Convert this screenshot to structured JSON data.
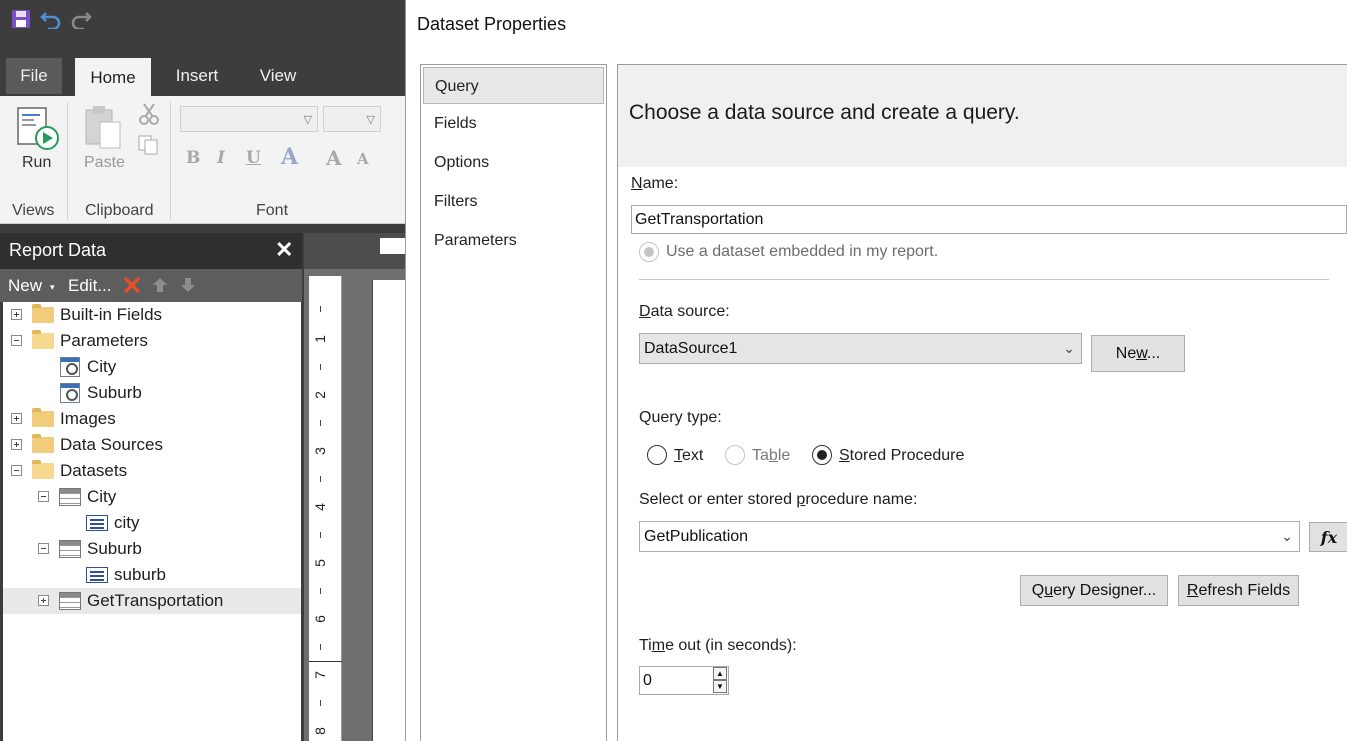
{
  "app": {
    "ribbon_tabs": [
      "File",
      "Home",
      "Insert",
      "View"
    ],
    "ribbon": {
      "run_label": "Run",
      "paste_label": "Paste",
      "groups": [
        "Views",
        "Clipboard",
        "Font"
      ],
      "format_buttons": [
        "B",
        "I",
        "U",
        "A",
        "A",
        "A"
      ]
    },
    "report_data": {
      "title": "Report Data",
      "close_glyph": "✕",
      "toolbar": {
        "new_label": "New",
        "edit_label": "Edit..."
      },
      "tree": {
        "builtin_fields": "Built-in Fields",
        "parameters": "Parameters",
        "param_city": "City",
        "param_suburb": "Suburb",
        "images": "Images",
        "data_sources": "Data Sources",
        "datasets": "Datasets",
        "ds_city": "City",
        "field_city": "city",
        "ds_suburb": "Suburb",
        "field_suburb": "suburb",
        "ds_gettransportation": "GetTransportation"
      }
    },
    "ruler_numbers": [
      "1",
      "2",
      "3",
      "4",
      "5",
      "6",
      "7",
      "8"
    ]
  },
  "dialog": {
    "title": "Dataset Properties",
    "nav": [
      "Query",
      "Fields",
      "Options",
      "Filters",
      "Parameters"
    ],
    "heading": "Choose a data source and create a query.",
    "name": {
      "label_first": "N",
      "label_rest": "ame:",
      "value": "GetTransportation"
    },
    "embedded_option": "Use a dataset embedded in my report.",
    "data_source": {
      "label_first": "D",
      "label_rest": "ata source:",
      "value": "DataSource1",
      "new_button_pre": "Ne",
      "new_button_ul": "w",
      "new_button_post": "..."
    },
    "query_type": {
      "label": "Query type:",
      "text_ul": "T",
      "text_rest": "ext",
      "table_pre": "Ta",
      "table_ul": "b",
      "table_post": "le",
      "sp_ul": "S",
      "sp_rest": "tored Procedure",
      "selected": "Stored Procedure"
    },
    "sp_name": {
      "label_pre": "Select or enter stored ",
      "label_ul": "p",
      "label_post": "rocedure name:",
      "value": "GetPublication"
    },
    "fx_label": "fx",
    "query_designer": {
      "pre": "Q",
      "ul": "u",
      "post": "ery Designer..."
    },
    "refresh_fields": {
      "ul": "R",
      "post": "efresh Fields"
    },
    "timeout": {
      "label_pre": "Ti",
      "label_ul": "m",
      "label_post": "e out (in seconds):",
      "value": "0"
    }
  }
}
